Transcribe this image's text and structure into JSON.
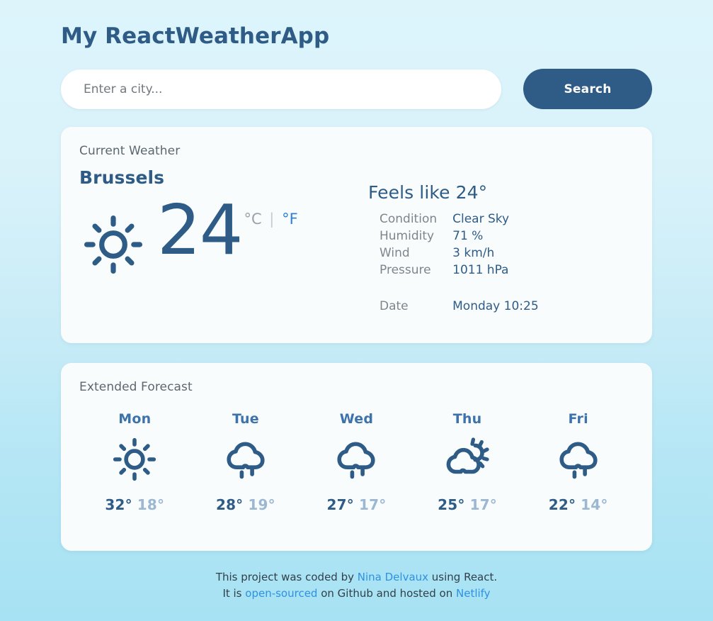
{
  "header": {
    "title": "My ReactWeatherApp"
  },
  "search": {
    "placeholder": "Enter a city...",
    "value": "",
    "button_label": "Search"
  },
  "current": {
    "section_label": "Current Weather",
    "city": "Brussels",
    "icon": "sun-icon",
    "temperature": "24",
    "unit_celsius": "°C",
    "unit_separator": "|",
    "unit_fahrenheit": "°F",
    "feels_like": "Feels like 24°",
    "details": [
      {
        "key": "Condition",
        "value": "Clear Sky"
      },
      {
        "key": "Humidity",
        "value": "71 %"
      },
      {
        "key": "Wind",
        "value": "3 km/h"
      },
      {
        "key": "Pressure",
        "value": "1011 hPa"
      }
    ],
    "date_label": "Date",
    "date_value": "Monday 10:25"
  },
  "forecast": {
    "section_label": "Extended Forecast",
    "days": [
      {
        "day": "Mon",
        "icon": "sun-icon",
        "max": "32°",
        "min": "18°"
      },
      {
        "day": "Tue",
        "icon": "rain-cloud-icon",
        "max": "28°",
        "min": "19°"
      },
      {
        "day": "Wed",
        "icon": "rain-cloud-icon",
        "max": "27°",
        "min": "17°"
      },
      {
        "day": "Thu",
        "icon": "sun-behind-cloud-icon",
        "max": "25°",
        "min": "17°"
      },
      {
        "day": "Fri",
        "icon": "rain-cloud-icon",
        "max": "22°",
        "min": "14°"
      }
    ]
  },
  "footer": {
    "line1_pre": "This project was coded by ",
    "author": "Nina Delvaux",
    "line1_post": " using React.",
    "line2_pre": "It is ",
    "opensource": "open-sourced",
    "line2_mid": " on Github and hosted on ",
    "netlify": "Netlify"
  },
  "colors": {
    "accent": "#2e5c86",
    "link": "#2f91e3",
    "day_label": "#3d72ab",
    "min_temp": "#9bb7d2",
    "card_bg": "#f9fcfd",
    "bg_top": "#ddf4fb",
    "bg_bottom": "#a6e2f3"
  }
}
